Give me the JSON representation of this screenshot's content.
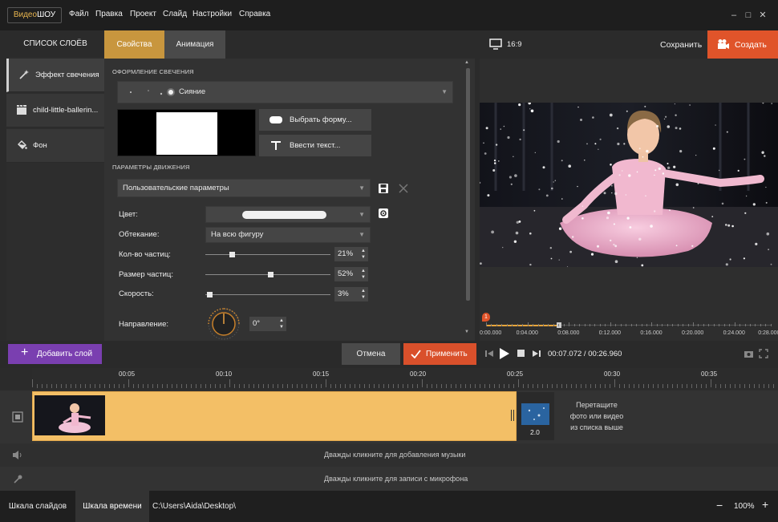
{
  "app": {
    "logo_part1": "Видео",
    "logo_part2": "ШОУ"
  },
  "menu": [
    "Файл",
    "Правка",
    "Проект",
    "Слайд",
    "Настройки",
    "Справка"
  ],
  "window_controls": {
    "minimize": "–",
    "maximize": "□",
    "close": "✕"
  },
  "layers": {
    "header": "СПИСОК СЛОЁВ",
    "items": [
      {
        "label": "Эффект свечения",
        "icon": "wand-icon"
      },
      {
        "label": "child-little-ballerin...",
        "icon": "film-icon"
      },
      {
        "label": "Фон",
        "icon": "paint-bucket-icon"
      }
    ],
    "add_button": "Добавить слой"
  },
  "tabs": {
    "properties": "Свойства",
    "animation": "Анимация"
  },
  "properties": {
    "glow_section": "ОФОРМЛЕНИЕ СВЕЧЕНИЯ",
    "glow_type": "Сияние",
    "choose_shape": "Выбрать форму...",
    "enter_text": "Ввести текст...",
    "motion_section": "ПАРАМЕТРЫ ДВИЖЕНИЯ",
    "motion_preset": "Пользовательские параметры",
    "color_label": "Цвет:",
    "flow_label": "Обтекание:",
    "flow_value": "На всю фигуру",
    "count_label": "Кол-во частиц:",
    "count_value": "21%",
    "count_level": 0.21,
    "size_label": "Размер частиц:",
    "size_value": "52%",
    "size_level": 0.52,
    "speed_label": "Скорость:",
    "speed_value": "3%",
    "speed_level": 0.03,
    "direction_label": "Направление:",
    "direction_value": "0°"
  },
  "preview": {
    "aspect": "16:9",
    "save": "Сохранить",
    "create": "Создать",
    "timecodes": [
      "0:00.000",
      "0:04.000",
      "0:08.000",
      "0:12.000",
      "0:16.000",
      "0:20.000",
      "0:24.000",
      "0:28.000"
    ],
    "current_time": "00:07.072",
    "total_time": "00:26.960",
    "marker": "1"
  },
  "actions": {
    "cancel": "Отмена",
    "apply": "Применить"
  },
  "timeline": {
    "ruler": [
      "00:05",
      "00:10",
      "00:15",
      "00:20",
      "00:25",
      "00:30",
      "00:35"
    ],
    "transition_duration": "2.0",
    "drop_hint_line1": "Перетащите",
    "drop_hint_line2": "фото или видео",
    "drop_hint_line3": "из списка выше",
    "music_hint": "Дважды кликните для добавления музыки",
    "mic_hint": "Дважды кликните для записи с микрофона"
  },
  "bottom": {
    "tab_slides": "Шкала слайдов",
    "tab_timeline": "Шкала времени",
    "path": "C:\\Users\\Aida\\Desktop\\",
    "zoom": "100%",
    "zoom_out": "−",
    "zoom_in": "+"
  },
  "colors": {
    "accent_orange": "#c8963e",
    "create_red": "#e0542a",
    "apply_red": "#d9502b",
    "add_layer_purple": "#7a3fb0",
    "clip_yellow": "#f3bf66"
  }
}
